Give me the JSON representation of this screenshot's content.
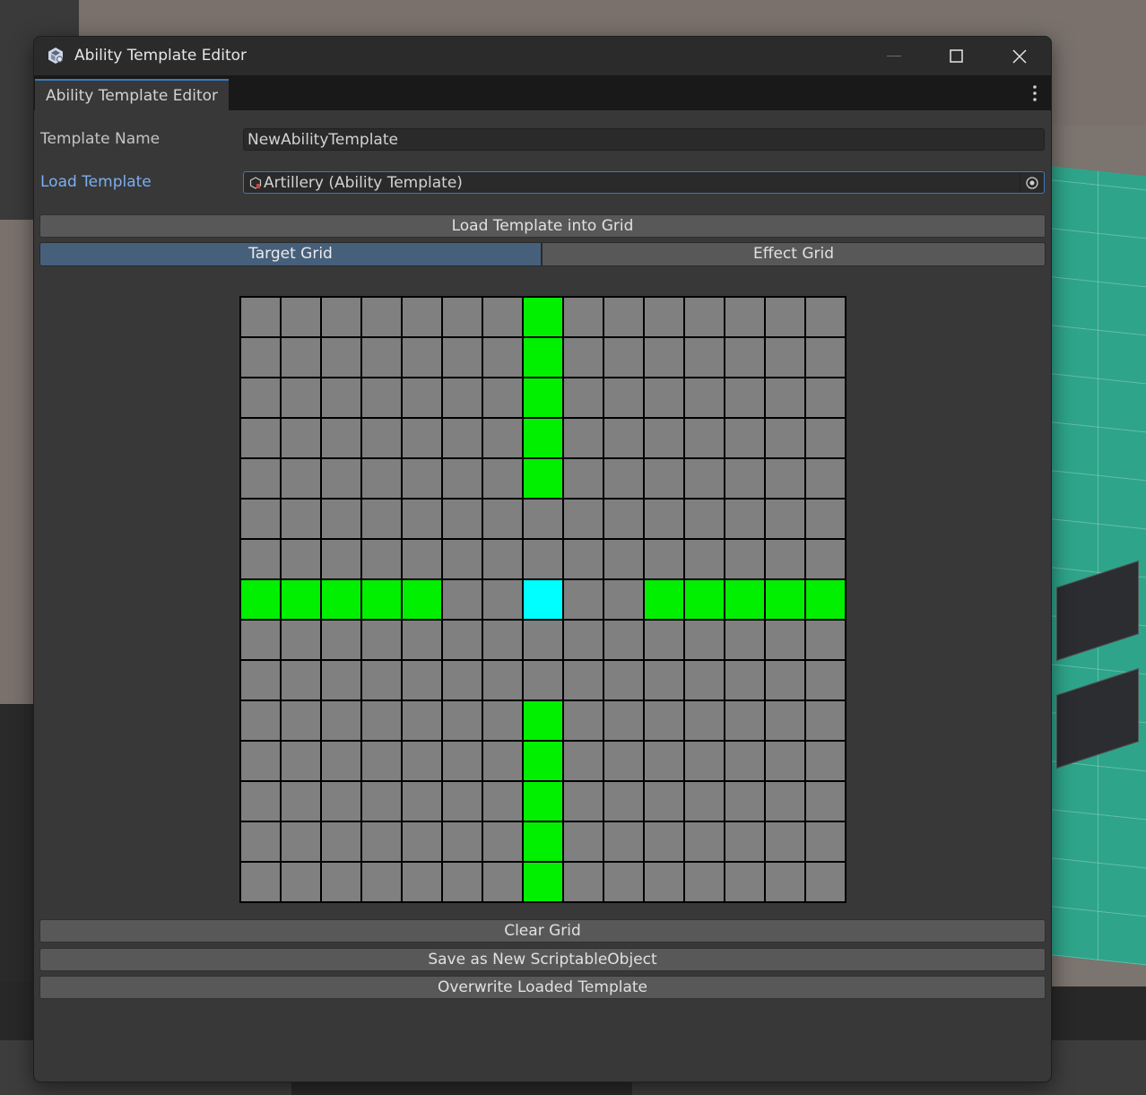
{
  "window": {
    "title": "Ability Template Editor",
    "tab_label": "Ability Template Editor"
  },
  "form": {
    "template_name_label": "Template Name",
    "template_name_value": "NewAbilityTemplate",
    "load_template_label": "Load Template",
    "load_template_value": "Artillery (Ability Template)"
  },
  "buttons": {
    "load_into_grid": "Load Template into Grid",
    "clear_grid": "Clear Grid",
    "save_new": "Save as New ScriptableObject",
    "overwrite": "Overwrite Loaded Template"
  },
  "grid_toggle": {
    "target_label": "Target Grid",
    "effect_label": "Effect Grid",
    "selected": "Target Grid"
  },
  "colors": {
    "empty_cell": "#808080",
    "active_cell": "#00f000",
    "center_cell": "#00ffff",
    "accent": "#3a79bb"
  },
  "grid": {
    "size": 15,
    "rows": [
      "_______G_______",
      "_______G_______",
      "_______G_______",
      "_______G_______",
      "_______G_______",
      "_______________",
      "_______________",
      "GGGGG__C__GGGGG",
      "_______________",
      "_______________",
      "_______G_______",
      "_______G_______",
      "_______G_______",
      "_______G_______",
      "_______G_______"
    ]
  }
}
